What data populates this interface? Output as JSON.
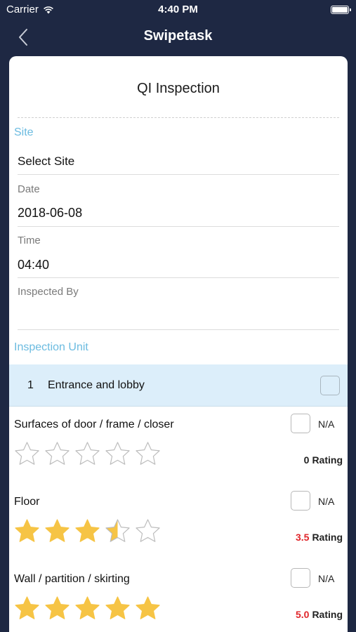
{
  "status_bar": {
    "carrier": "Carrier",
    "time": "4:40 PM"
  },
  "nav": {
    "title": "Swipetask"
  },
  "form": {
    "title": "QI Inspection",
    "site": {
      "section_label": "Site",
      "value": "Select Site"
    },
    "date": {
      "label": "Date",
      "value": "2018-06-08"
    },
    "time": {
      "label": "Time",
      "value": "04:40"
    },
    "inspected_by": {
      "label": "Inspected By",
      "value": ""
    },
    "inspection_unit_label": "Inspection Unit"
  },
  "unit": {
    "number": "1",
    "name": "Entrance and lobby",
    "checked": false
  },
  "items": [
    {
      "title": "Surfaces of  door / frame / closer",
      "na_label": "N/A",
      "rating": 0,
      "rating_display": "0",
      "rating_suffix": "Rating"
    },
    {
      "title": "Floor",
      "na_label": "N/A",
      "rating": 3.5,
      "rating_display": "3.5",
      "rating_suffix": "Rating"
    },
    {
      "title": "Wall / partition / skirting",
      "na_label": "N/A",
      "rating": 5,
      "rating_display": "5.0",
      "rating_suffix": "Rating"
    }
  ],
  "colors": {
    "background": "#1e2843",
    "accent": "#6bbbe0",
    "star_fill": "#f6c445",
    "rating_highlight": "#e0252a",
    "unit_row": "#dceefa"
  },
  "icons": {
    "back": "chevron-left-icon",
    "wifi": "wifi-icon",
    "battery": "battery-icon",
    "star": "star-icon"
  }
}
